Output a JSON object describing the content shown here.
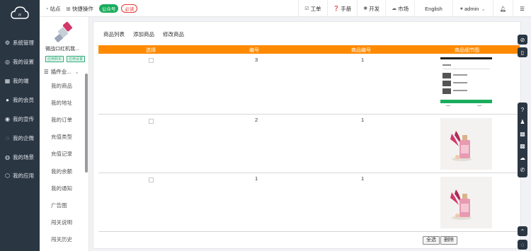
{
  "sidebar": {
    "items": [
      {
        "label": "系统管理",
        "icon": "gear-icon"
      },
      {
        "label": "我的设置",
        "icon": "settings-icon"
      },
      {
        "label": "我的端",
        "icon": "grid-icon"
      },
      {
        "label": "我的会员",
        "icon": "user-icon"
      },
      {
        "label": "我的宣传",
        "icon": "megaphone-icon"
      },
      {
        "label": "我的企微",
        "icon": "chat-icon"
      },
      {
        "label": "我的场景",
        "icon": "scene-icon"
      },
      {
        "label": "我的应用",
        "icon": "apps-icon"
      }
    ]
  },
  "subnav": {
    "product_name": "微战口红机我...",
    "tags": [
      "应用购买",
      "应用设置"
    ],
    "plugin_label": "插件业...",
    "items": [
      "我的商品",
      "我的地址",
      "我的订单",
      "充值类型",
      "充值记录",
      "我的余额",
      "我的通知",
      "广告图",
      "闯关说明",
      "闯关历史"
    ]
  },
  "topbar": {
    "site": "站点",
    "quick": "快捷操作",
    "badge_green": "公众号",
    "badge_red": "必读",
    "right": [
      {
        "label": "工单",
        "icon": "ticket-icon"
      },
      {
        "label": "手册",
        "icon": "help-icon"
      },
      {
        "label": "开发",
        "icon": "dev-icon"
      },
      {
        "label": "市场",
        "icon": "cloud-icon"
      },
      {
        "label": "English",
        "icon": ""
      },
      {
        "label": "admin",
        "icon": "user-icon"
      }
    ]
  },
  "main": {
    "tabs": [
      "商品列表",
      "添加商品",
      "修改商品"
    ],
    "columns": [
      "选择",
      "编号",
      "商品编号",
      "商品细节图"
    ],
    "rows": [
      {
        "id": "3",
        "product_id": "1",
        "image": "phone-screenshot"
      },
      {
        "id": "2",
        "product_id": "1",
        "image": "perfume"
      },
      {
        "id": "1",
        "product_id": "1",
        "image": "perfume"
      }
    ],
    "select_all": "全选",
    "delete": "删除"
  },
  "colors": {
    "sidebar_bg": "#2b3643",
    "table_header": "#ff8a00",
    "badge_green": "#1aad5c",
    "badge_red": "#e53935"
  }
}
